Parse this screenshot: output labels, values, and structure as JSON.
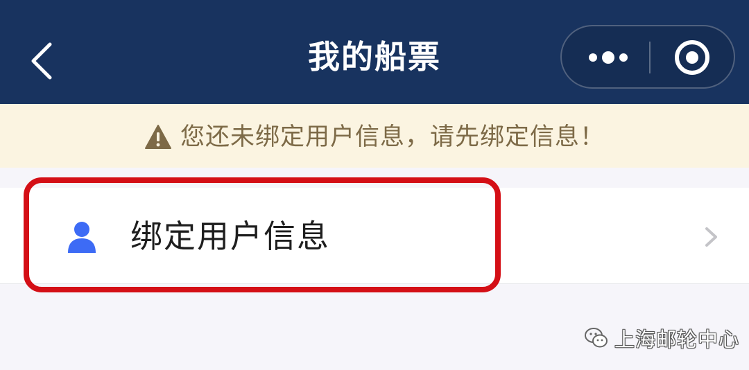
{
  "header": {
    "title": "我的船票",
    "back_icon": "chevron-left-icon",
    "more_icon": "more-dots-icon",
    "close_icon": "mini-program-close-icon",
    "background_color": "#18335f"
  },
  "notice": {
    "icon": "warning-triangle-icon",
    "text": "您还未绑定用户信息，请先绑定信息！",
    "background_color": "#fbf4e1",
    "text_color": "#7d6a47"
  },
  "menu": {
    "items": [
      {
        "icon": "user-icon",
        "label": "绑定用户信息",
        "trailing_icon": "chevron-right-icon",
        "icon_color": "#3d6bf5"
      }
    ]
  },
  "annotation": {
    "highlight_color": "#d40f16"
  },
  "watermark": {
    "icon": "wechat-icon",
    "text": "上海邮轮中心"
  }
}
